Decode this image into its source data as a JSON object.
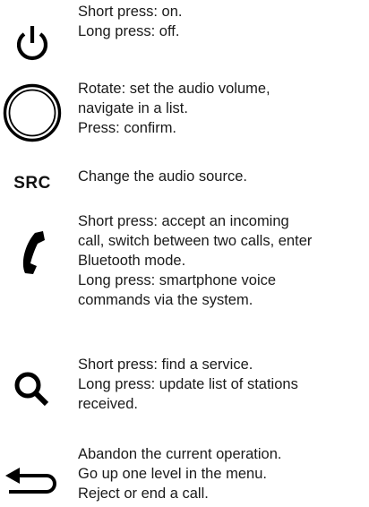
{
  "controls": [
    {
      "icon": "power-icon",
      "lines": [
        "Short press: on.",
        "Long press: off."
      ]
    },
    {
      "icon": "rotary-knob-icon",
      "lines": [
        "Rotate: set the audio volume,",
        "navigate in a list.",
        "Press: confirm."
      ]
    },
    {
      "icon": "src-label",
      "icon_text": "SRC",
      "lines": [
        "Change the audio source."
      ]
    },
    {
      "icon": "phone-handset-icon",
      "lines": [
        "Short press: accept an incoming",
        "call, switch between two calls, enter",
        "Bluetooth mode.",
        "Long press: smartphone voice",
        "commands via the system."
      ]
    },
    {
      "icon": "search-icon",
      "lines": [
        "Short press: find a service.",
        "Long press: update list of stations",
        "received."
      ]
    },
    {
      "icon": "back-arrow-icon",
      "lines": [
        "Abandon the current operation.",
        "Go up one level in the menu.",
        "Reject or end a call."
      ]
    }
  ]
}
